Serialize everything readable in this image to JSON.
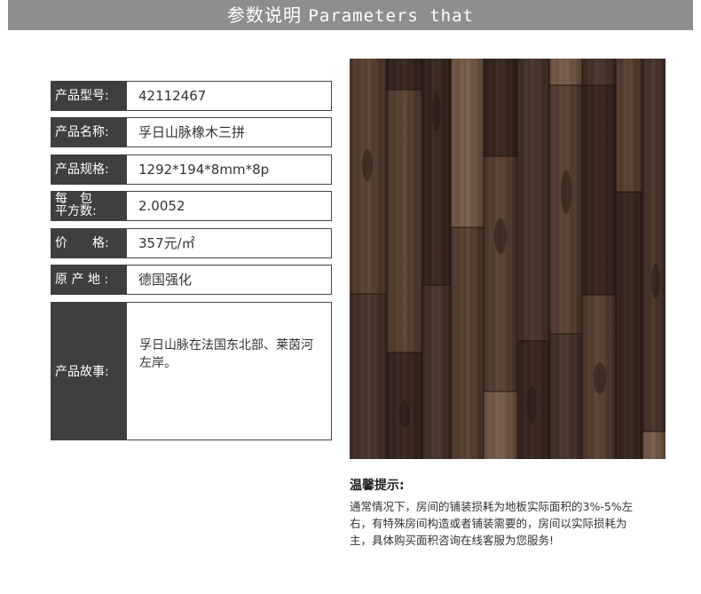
{
  "header": {
    "title_cn": "参数说明",
    "title_en": "Parameters that"
  },
  "params": [
    {
      "label": "产品型号:",
      "value": "42112467"
    },
    {
      "label": "产品名称:",
      "value": "孚日山脉橡木三拼"
    },
    {
      "label": "产品规格:",
      "value": "1292*194*8mm*8p"
    },
    {
      "label_line1": "每包",
      "label_line2": "平方数:",
      "value": "2.0052"
    },
    {
      "label": "价　　格:",
      "value": "357元/㎡"
    },
    {
      "label": "原 产 地 :",
      "value": "德国强化"
    }
  ],
  "story": {
    "label": "产品故事:",
    "value": "孚日山脉在法国东北部、莱茵河左岸。"
  },
  "tips": {
    "title": "温馨提示:",
    "body": "通常情况下，房间的铺装损耗为地板实际面积的3%-5%左右，有特殊房间构造或者铺装需要的，房间以实际损耗为主，具体购买面积咨询在线客服为您服务!"
  },
  "colors": {
    "banner": "#8e8e8e",
    "label_bg": "#3f3f3f",
    "wood_dark": "#3a2a22",
    "wood_mid": "#5a4334"
  }
}
